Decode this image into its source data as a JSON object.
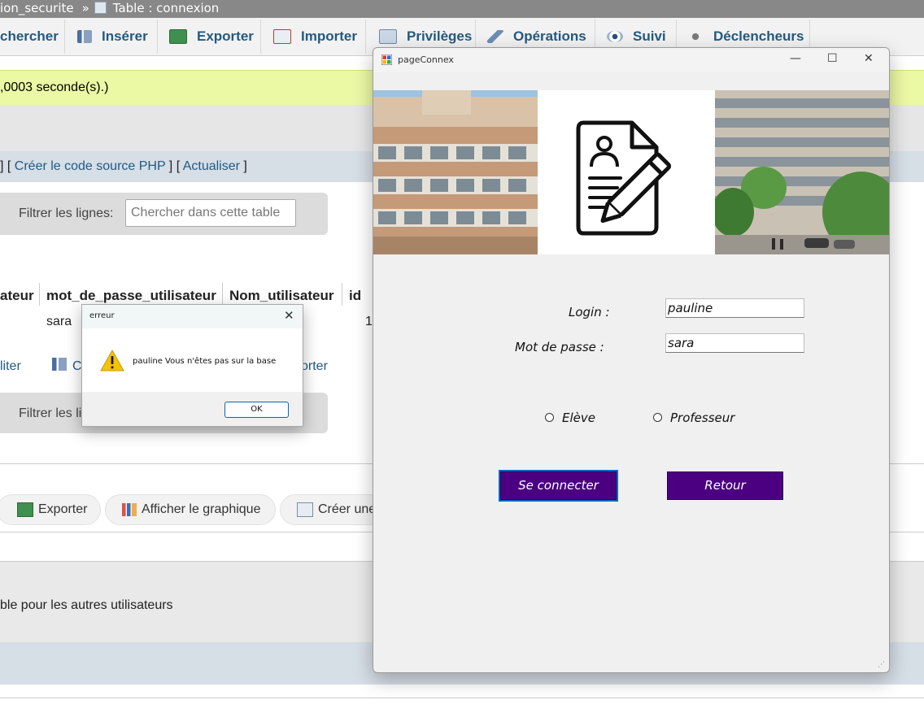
{
  "pma": {
    "breadcrumb": {
      "db": "ion_securite",
      "separator": "»",
      "table": "Table : connexion"
    },
    "tabs": [
      {
        "label": "chercher"
      },
      {
        "label": "Insérer"
      },
      {
        "label": "Exporter"
      },
      {
        "label": "Importer"
      },
      {
        "label": "Privilèges"
      },
      {
        "label": "Opérations"
      },
      {
        "label": "Suivi"
      },
      {
        "label": "Déclencheurs"
      }
    ],
    "success_msg": ",0003 seconde(s).)",
    "links": {
      "prefix": "] [ ",
      "create_php": "Créer le code source PHP",
      "middle": " ] [ ",
      "refresh": "Actualiser",
      "suffix": " ]"
    },
    "filter_label": "Filtrer les lignes:",
    "filter_placeholder": "Chercher dans cette table",
    "filter_label_2": "Filtrer les li",
    "columns": [
      "ateur",
      "mot_de_passe_utilisateur",
      "Nom_utilisateur",
      "id"
    ],
    "row": {
      "password": "sara",
      "id": "1"
    },
    "edit_link": "liter",
    "copy_link": "C",
    "export_link": "orter",
    "pills": [
      {
        "label": "Exporter"
      },
      {
        "label": "Afficher le graphique"
      },
      {
        "label": "Créer une"
      }
    ],
    "note": "ble pour les autres utilisateurs"
  },
  "error_dialog": {
    "title": "erreur",
    "message": "pauline Vous n'êtes pas sur la base",
    "ok_label": "OK"
  },
  "app": {
    "title": "pageConnex",
    "login_label": "Login :",
    "login_value": "pauline",
    "password_label": "Mot de passe :",
    "password_value": "sara",
    "radio_student": "Elève",
    "radio_teacher": "Professeur",
    "connect_label": "Se connecter",
    "back_label": "Retour",
    "button_color": "#4b0082"
  }
}
